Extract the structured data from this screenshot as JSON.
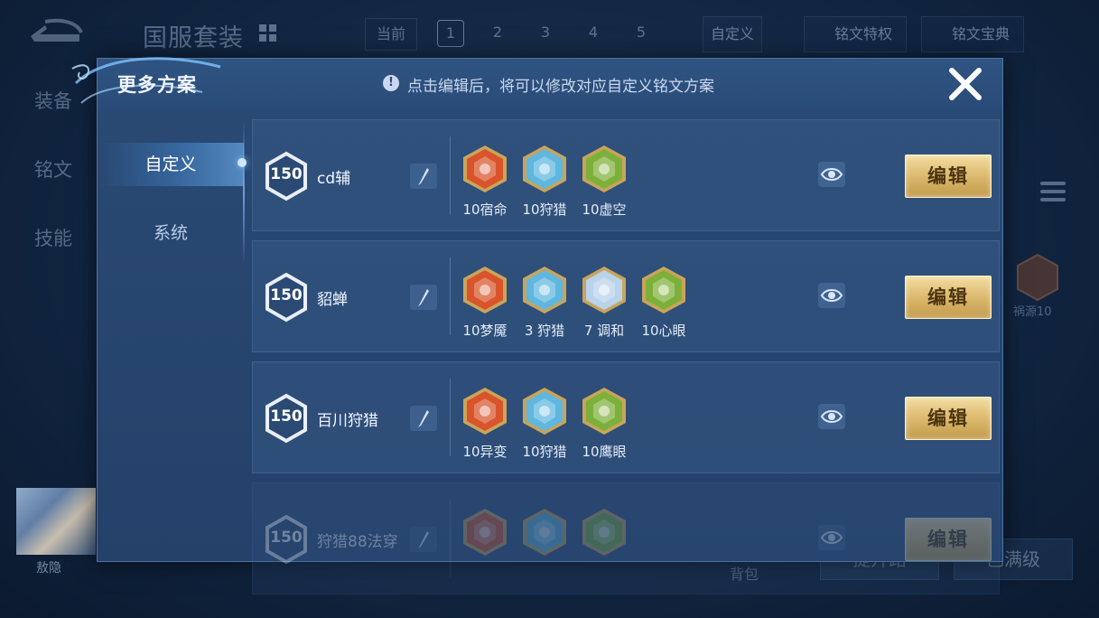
{
  "background": {
    "suit_title": "国服套装",
    "current_label": "当前",
    "slots": [
      "1",
      "2",
      "3",
      "4",
      "5"
    ],
    "active_slot": "1",
    "custom_btn": "自定义",
    "privilege_btn": "铭文特权",
    "codex_btn": "铭文宝典",
    "side_tabs": [
      "装备",
      "铭文",
      "技能"
    ],
    "right_rune_label": "祸源10",
    "hero_name": "敖隐",
    "bag_label": "背包",
    "bottom_btn_1": "提升路",
    "bottom_btn_2": "已满级"
  },
  "modal": {
    "title": "更多方案",
    "tip_icon": "!",
    "tip": "点击编辑后，将可以修改对应自定义铭文方案",
    "close_icon": "close-icon"
  },
  "nav": [
    {
      "label": "自定义",
      "active": true
    },
    {
      "label": "系统",
      "active": false
    }
  ],
  "rows": [
    {
      "level": "150",
      "name": "cd辅",
      "edit_label": "编辑",
      "runes": [
        {
          "color": "red",
          "label": "10宿命"
        },
        {
          "color": "blue",
          "label": "10狩猎"
        },
        {
          "color": "green",
          "label": "10虚空"
        }
      ]
    },
    {
      "level": "150",
      "name": "貂蝉",
      "edit_label": "编辑",
      "runes": [
        {
          "color": "red",
          "label": "10梦魇"
        },
        {
          "color": "blue",
          "label": "3 狩猎"
        },
        {
          "color": "silver",
          "label": "7 调和"
        },
        {
          "color": "green",
          "label": "10心眼"
        }
      ]
    },
    {
      "level": "150",
      "name": "百川狩猎",
      "edit_label": "编辑",
      "runes": [
        {
          "color": "red",
          "label": "10异变"
        },
        {
          "color": "blue",
          "label": "10狩猎"
        },
        {
          "color": "green",
          "label": "10鹰眼"
        }
      ]
    },
    {
      "level": "150",
      "name": "狩猎88法穿",
      "edit_label": "编辑",
      "runes": [
        {
          "color": "red",
          "label": ""
        },
        {
          "color": "blue",
          "label": ""
        },
        {
          "color": "green",
          "label": ""
        }
      ]
    }
  ],
  "colors": {
    "red": "#d9542a",
    "blue": "#5fb7e0",
    "green": "#7db03a",
    "silver": "#b9d3ea",
    "gold": "#d9b66a"
  }
}
